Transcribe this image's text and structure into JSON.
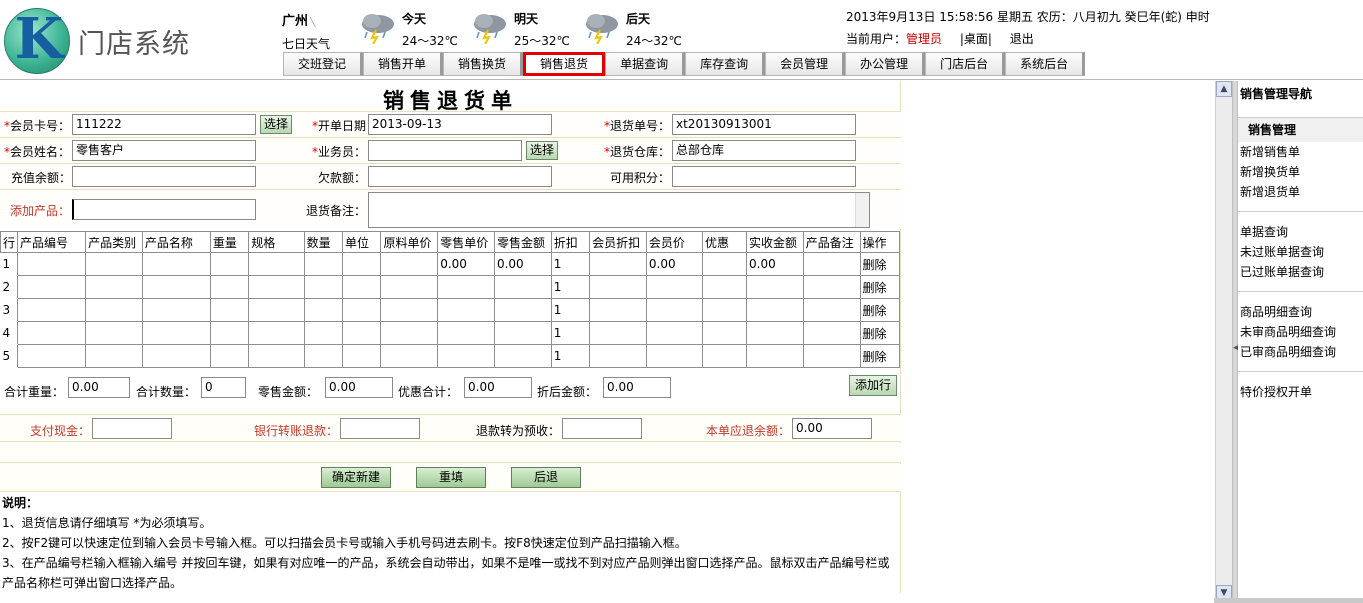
{
  "header": {
    "logo_letter": "K",
    "logo_text": "门店系统",
    "city": "广州",
    "forecast_label": "七日天气",
    "days": [
      {
        "label": "今天",
        "temp": "24～32℃"
      },
      {
        "label": "明天",
        "temp": "25～32℃"
      },
      {
        "label": "后天",
        "temp": "24～32℃"
      }
    ],
    "datetime": "2013年9月13日  15:58:56 星期五  农历：八月初九  癸巳年(蛇) 申时",
    "current_user_label": "当前用户：",
    "current_user": "管理员",
    "desktop_link": "|桌面|",
    "logout_link": "退出"
  },
  "tabs": [
    {
      "label": "交班登记"
    },
    {
      "label": "销售开单"
    },
    {
      "label": "销售换货"
    },
    {
      "label": "销售退货",
      "active": true
    },
    {
      "label": "单据查询"
    },
    {
      "label": "库存查询"
    },
    {
      "label": "会员管理"
    },
    {
      "label": "办公管理"
    },
    {
      "label": "门店后台"
    },
    {
      "label": "系统后台"
    }
  ],
  "form": {
    "title": "销售退货单",
    "member_card_label": "会员卡号：",
    "member_card_value": "111222",
    "select_label": "选择",
    "open_date_label": "开单日期：",
    "open_date_value": "2013-09-13",
    "return_no_label": "退货单号：",
    "return_no_value": "xt20130913001",
    "member_name_label": "会员姓名：",
    "member_name_value": "零售客户",
    "salesman_label": "业务员：",
    "salesman_value": "",
    "warehouse_label": "退货仓库：",
    "warehouse_value": "总部仓库",
    "balance_label": "充值余额：",
    "debt_label": "欠款额：",
    "points_label": "可用积分：",
    "add_product_label": "添加产品：",
    "remark_label": "退货备注："
  },
  "table": {
    "headers": [
      "行",
      "产品编号",
      "产品类别",
      "产品名称",
      "重量",
      "规格",
      "数量",
      "单位",
      "原料单价",
      "零售单价",
      "零售金额",
      "折扣",
      "会员折扣",
      "会员价",
      "优惠",
      "实收金额",
      "产品备注",
      "操作"
    ],
    "rows": [
      {
        "num": "1",
        "retail_price": "0.00",
        "retail_amount": "0.00",
        "discount": "1",
        "member_price": "0.00",
        "actual_amount": "0.00",
        "action": "删除"
      },
      {
        "num": "2",
        "retail_price": "",
        "retail_amount": "",
        "discount": "1",
        "member_price": "",
        "actual_amount": "",
        "action": "删除"
      },
      {
        "num": "3",
        "retail_price": "",
        "retail_amount": "",
        "discount": "1",
        "member_price": "",
        "actual_amount": "",
        "action": "删除"
      },
      {
        "num": "4",
        "retail_price": "",
        "retail_amount": "",
        "discount": "1",
        "member_price": "",
        "actual_amount": "",
        "action": "删除"
      },
      {
        "num": "5",
        "retail_price": "",
        "retail_amount": "",
        "discount": "1",
        "member_price": "",
        "actual_amount": "",
        "action": "删除"
      }
    ]
  },
  "totals": {
    "weight_label": "合计重量：",
    "weight_value": "0.00",
    "qty_label": "合计数量：",
    "qty_value": "0",
    "retail_label": "零售金额：",
    "retail_value": "0.00",
    "discount_label": "优惠合计：",
    "discount_value": "0.00",
    "after_label": "折后金额：",
    "after_value": "0.00",
    "add_row_label": "添加行"
  },
  "payment": {
    "cash_label": "支付现金：",
    "bank_label": "银行转账退款：",
    "prepay_label": "退款转为预收：",
    "refund_label": "本单应退余额：",
    "refund_value": "0.00"
  },
  "actions": {
    "confirm_label": "确定新建",
    "reset_label": "重填",
    "back_label": "后退"
  },
  "notes": {
    "title": "说明：",
    "lines": [
      "1、退货信息请仔细填写 *为必须填写。",
      "2、按F2键可以快速定位到输入会员卡号输入框。可以扫描会员卡号或输入手机号码进去刷卡。按F8快速定位到产品扫描输入框。",
      "3、在产品编号栏输入框输入编号 并按回车键，如果有对应唯一的产品，系统会自动带出，如果不是唯一或找不到对应产品则弹出窗口选择产品。鼠标双击产品编号栏或",
      "产品名称栏可弹出窗口选择产品。"
    ]
  },
  "nav": {
    "title": "销售管理导航",
    "group_title": "销售管理",
    "groups": [
      [
        "新增销售单",
        "新增换货单",
        "新增退货单"
      ],
      [
        "单据查询",
        "未过账单据查询",
        "已过账单据查询"
      ],
      [
        "商品明细查询",
        "未审商品明细查询",
        "已审商品明细查询"
      ],
      [
        "特价授权开单"
      ]
    ]
  },
  "colors": {
    "required": "#e00000",
    "active_tab_border": "#e00000",
    "button_green": "#b9d7b2"
  }
}
